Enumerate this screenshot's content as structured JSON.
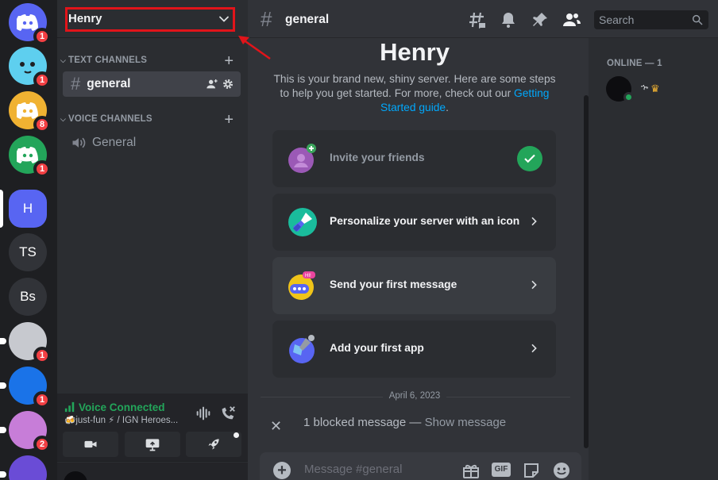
{
  "servers": [
    {
      "label": "",
      "kind": "discord",
      "color": "#5865f2",
      "badge": "1"
    },
    {
      "label": "",
      "kind": "face",
      "color": "#5ecfef",
      "badge": "1"
    },
    {
      "label": "",
      "kind": "discord",
      "color": "#f0b232",
      "badge": "8"
    },
    {
      "label": "",
      "kind": "discord",
      "color": "#23a55a",
      "badge": "1"
    },
    {
      "label": "H",
      "kind": "text",
      "color": "#5865f2",
      "badge": ""
    },
    {
      "label": "TS",
      "kind": "text",
      "color": "#313338",
      "badge": ""
    },
    {
      "label": "Bs",
      "kind": "text",
      "color": "#313338",
      "badge": ""
    },
    {
      "label": "",
      "kind": "image",
      "color": "#c7c9cf",
      "badge": "1"
    },
    {
      "label": "",
      "kind": "image",
      "color": "#1a73e8",
      "badge": "1"
    },
    {
      "label": "",
      "kind": "image",
      "color": "#c77dd8",
      "badge": "2"
    },
    {
      "label": "",
      "kind": "image",
      "color": "#6a4cd6",
      "badge": ""
    }
  ],
  "sidebar": {
    "server_name": "Henry",
    "text_category": "TEXT CHANNELS",
    "voice_category": "VOICE CHANNELS",
    "text_channels": [
      {
        "name": "general"
      }
    ],
    "voice_channels": [
      {
        "name": "General"
      }
    ],
    "voice_connected": {
      "title": "Voice Connected",
      "subtitle": "🍻just-fun ⚡ / IGN Heroes..."
    }
  },
  "header": {
    "channel": "general",
    "search_placeholder": "Search"
  },
  "welcome": {
    "title": "Henry",
    "desc_text": "This is your brand new, shiny server. Here are some steps to help you get started. For more, check out our ",
    "desc_link": "Getting Started guide",
    "desc_end": ".",
    "cards": [
      {
        "label": "Invite your friends",
        "done": true
      },
      {
        "label": "Personalize your server with an icon",
        "done": false
      },
      {
        "label": "Send your first message",
        "done": false
      },
      {
        "label": "Add your first app",
        "done": false
      }
    ]
  },
  "feed": {
    "date": "April 6, 2023",
    "blocked_text": "1 blocked message — ",
    "blocked_link": "Show message"
  },
  "composer": {
    "placeholder": "Message #general",
    "gif_label": "GIF"
  },
  "members": {
    "header": "ONLINE — 1",
    "user_name": "ኈ"
  }
}
